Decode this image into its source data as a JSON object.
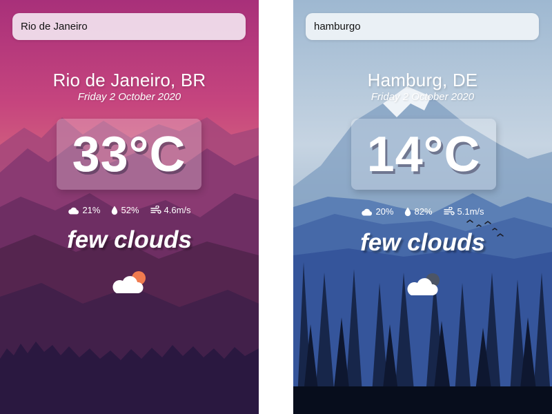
{
  "panels": [
    {
      "search": {
        "value": "Rio de Janeiro"
      },
      "location": "Rio de Janeiro, BR",
      "date": "Friday 2 October 2020",
      "temperature": "33°C",
      "stats": {
        "cloudiness": "21%",
        "humidity": "52%",
        "wind": "4.6m/s"
      },
      "description": "few clouds",
      "icon": "cloud-sun-icon",
      "theme": {
        "sky_top": "#b43f7f",
        "sky_mid": "#c95a85",
        "ground": "#2a1540",
        "sun_color": "#f07b4f"
      }
    },
    {
      "search": {
        "value": "hamburgo"
      },
      "location": "Hamburg, DE",
      "date": "Friday 2 October 2020",
      "temperature": "14°C",
      "stats": {
        "cloudiness": "20%",
        "humidity": "82%",
        "wind": "5.1m/s"
      },
      "description": "few clouds",
      "icon": "cloud-moon-icon",
      "theme": {
        "sky_top": "#9fb8d0",
        "sky_mid": "#c8d6e3",
        "ground": "#0d1a30",
        "moon_color": "#555f6e"
      }
    }
  ]
}
